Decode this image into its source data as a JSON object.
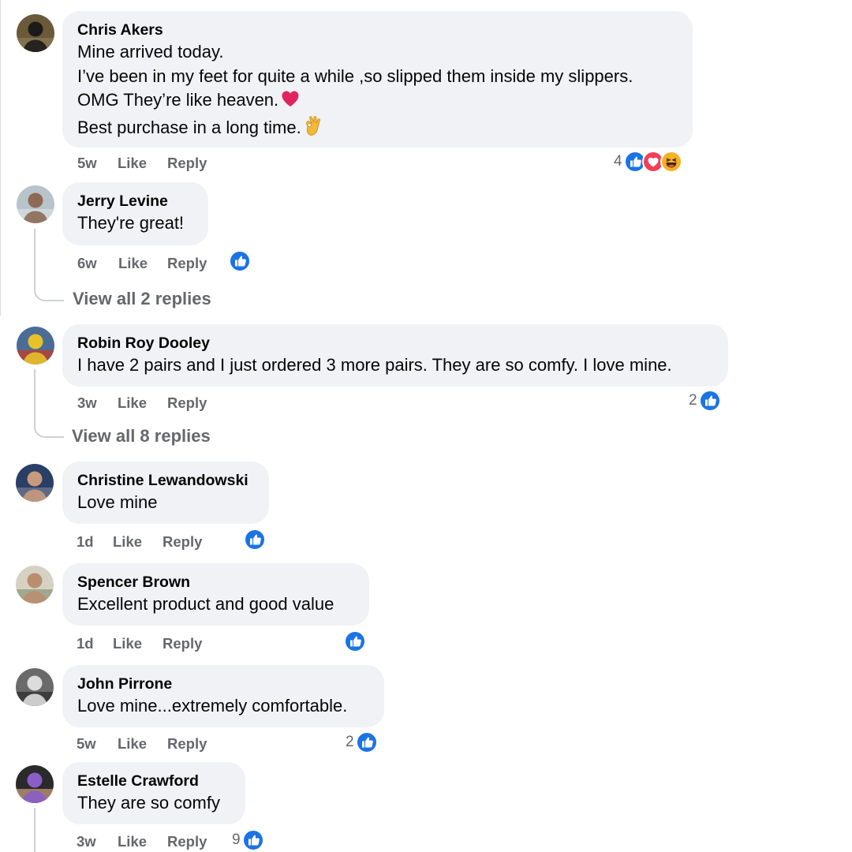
{
  "comments": [
    {
      "author": "Chris Akers",
      "lines": [
        "Mine arrived today.",
        "I’ve been in my feet for quite a while ,so slipped them inside my slippers.",
        "OMG They’re like heaven.",
        "Best purchase in a long time."
      ],
      "line_emoji": [
        "",
        "",
        "red-heart",
        "ok-hand"
      ],
      "time": "5w",
      "like_label": "Like",
      "reply_label": "Reply",
      "reaction_count": "4",
      "reactions": [
        "like",
        "love",
        "haha"
      ]
    },
    {
      "author": "Jerry Levine",
      "lines": [
        "They're great!"
      ],
      "time": "6w",
      "like_label": "Like",
      "reply_label": "Reply",
      "reaction_count": "",
      "reactions": [
        "like"
      ],
      "view_replies": "View all 2 replies"
    },
    {
      "author": "Robin Roy Dooley",
      "lines": [
        "I have 2 pairs and I just ordered 3 more pairs. They are so comfy. I love mine."
      ],
      "time": "3w",
      "like_label": "Like",
      "reply_label": "Reply",
      "reaction_count": "2",
      "reactions": [
        "like"
      ],
      "view_replies": "View all 8 replies"
    },
    {
      "author": "Christine Lewandowski",
      "lines": [
        "Love mine"
      ],
      "time": "1d",
      "like_label": "Like",
      "reply_label": "Reply",
      "reaction_count": "",
      "reactions": [
        "like"
      ]
    },
    {
      "author": "Spencer Brown",
      "lines": [
        "Excellent product and good value"
      ],
      "time": "1d",
      "like_label": "Like",
      "reply_label": "Reply",
      "reaction_count": "",
      "reactions": [
        "like"
      ]
    },
    {
      "author": "John Pirrone",
      "lines": [
        "Love mine...extremely comfortable."
      ],
      "time": "5w",
      "like_label": "Like",
      "reply_label": "Reply",
      "reaction_count": "2",
      "reactions": [
        "like"
      ]
    },
    {
      "author": "Estelle Crawford",
      "lines": [
        "They are so comfy"
      ],
      "time": "3w",
      "like_label": "Like",
      "reply_label": "Reply",
      "reaction_count": "9",
      "reactions": [
        "like"
      ]
    }
  ],
  "colors": {
    "bubble": "#f0f2f5",
    "text": "#050505",
    "secondary": "#65676b",
    "like_blue": "#1b74e4",
    "love_red": "#f33e58",
    "haha_yellow": "#f7b125",
    "heart_red": "#e0245e",
    "thread_line": "#ced0d4"
  }
}
